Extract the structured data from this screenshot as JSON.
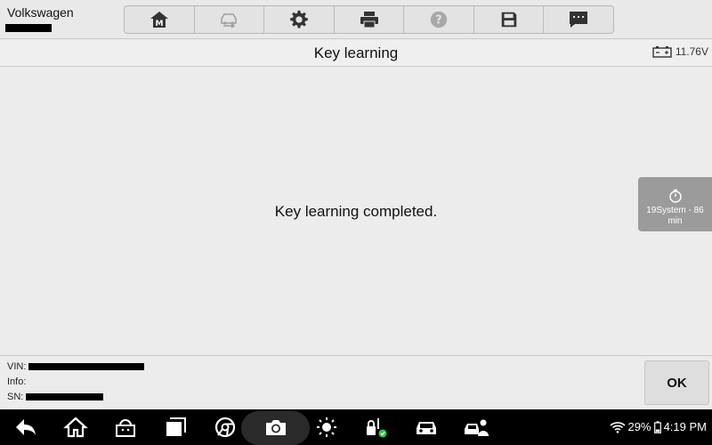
{
  "header": {
    "brand": "Volkswagen",
    "toolbar": [
      {
        "icon": "home-m-icon"
      },
      {
        "icon": "vehicle-swap-icon"
      },
      {
        "icon": "gear-icon"
      },
      {
        "icon": "printer-icon"
      },
      {
        "icon": "help-icon"
      },
      {
        "icon": "save-icon"
      },
      {
        "icon": "message-icon"
      }
    ]
  },
  "titlebar": {
    "title": "Key learning",
    "voltage": "11.76V"
  },
  "main": {
    "message": "Key learning completed.",
    "timer": {
      "label": "19System - 86 min"
    }
  },
  "footer": {
    "vin_label": "VIN:",
    "info_label": "Info:",
    "sn_label": "SN:",
    "ok_label": "OK"
  },
  "navbar": {
    "icons": [
      "back-icon",
      "home-icon",
      "android-store-icon",
      "recents-icon",
      "chrome-icon",
      "camera-icon",
      "brightness-icon",
      "remote-lock-icon",
      "car-icon",
      "car-person-icon"
    ],
    "battery": "29%",
    "time": "4:19 PM"
  },
  "colors": {
    "background": "#ececec",
    "navbar": "#000000",
    "timer_widget": "#9b9b9b"
  }
}
